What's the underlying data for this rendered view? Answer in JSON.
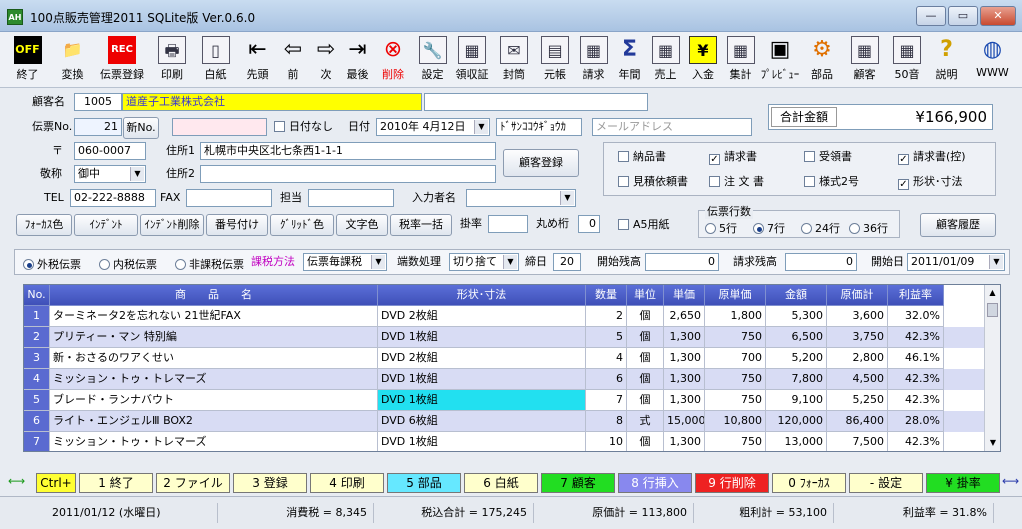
{
  "title": "100点販売管理2011 SQLite版 Ver.0.6.0",
  "app_icon": "AH",
  "toolbar": [
    {
      "label": "終了",
      "icon": "OFF"
    },
    {
      "label": "変換",
      "icon": "folder-icon"
    },
    {
      "label": "伝票登録",
      "icon": "REC"
    },
    {
      "label": "印刷",
      "icon": "printer-icon"
    },
    {
      "label": "白紙",
      "icon": "blank-page-icon"
    },
    {
      "label": "先頭",
      "icon": "first-icon"
    },
    {
      "label": "前",
      "icon": "prev-icon"
    },
    {
      "label": "次",
      "icon": "next-icon"
    },
    {
      "label": "最後",
      "icon": "last-icon"
    },
    {
      "label": "削除",
      "icon": "delete-icon"
    },
    {
      "label": "設定",
      "icon": "wrench-icon"
    },
    {
      "label": "領収証",
      "icon": "receipt-icon"
    },
    {
      "label": "封筒",
      "icon": "envelope-icon"
    },
    {
      "label": "元帳",
      "icon": "ledger-icon"
    },
    {
      "label": "請求",
      "icon": "invoice-icon"
    },
    {
      "label": "年間",
      "icon": "sigma-icon"
    },
    {
      "label": "売上",
      "icon": "sales-icon"
    },
    {
      "label": "入金",
      "icon": "yen-icon"
    },
    {
      "label": "集計",
      "icon": "summary-icon"
    },
    {
      "label": "ﾌﾟﾚﾋﾞｭｰ",
      "icon": "preview-icon"
    },
    {
      "label": "部品",
      "icon": "gear-icon"
    },
    {
      "label": "顧客",
      "icon": "customer-icon"
    },
    {
      "label": "50音",
      "icon": "kana-icon"
    },
    {
      "label": "説明",
      "icon": "help-icon"
    },
    {
      "label": "WWW",
      "icon": "globe-icon"
    }
  ],
  "form": {
    "customer_name_label": "顧客名",
    "customer_code": "1005",
    "customer_name": "道産子工業株式会社",
    "slip_no_label": "伝票No.",
    "slip_no": "21",
    "new_no_button": "新No.",
    "no_date_label": "日付なし",
    "date_label": "日付",
    "date": "2010年 4月12日",
    "kana": "ﾄﾞｻﾝｺｺｳｷﾞｮｳｶ",
    "email_placeholder": "メールアドレス",
    "total_label": "合計金額",
    "total": "¥166,900",
    "postal_label": "〒",
    "postal": "060-0007",
    "address1_label": "住所1",
    "address1": "札幌市中央区北七条西1-1-1",
    "register_customer_button": "顧客登録",
    "honorific_label": "敬称",
    "honorific": "御中",
    "address2_label": "住所2",
    "tel_label": "TEL",
    "tel": "02-222-8888",
    "fax_label": "FAX",
    "person_label": "担当",
    "entry_name_label": "入力者名"
  },
  "checks": [
    {
      "label": "納品書",
      "checked": false
    },
    {
      "label": "請求書",
      "checked": true
    },
    {
      "label": "受領書",
      "checked": false
    },
    {
      "label": "請求書(控)",
      "checked": true
    },
    {
      "label": "見積依頼書",
      "checked": false
    },
    {
      "label": "注 文 書",
      "checked": false
    },
    {
      "label": "様式2号",
      "checked": false
    },
    {
      "label": "形状･寸法",
      "checked": true
    }
  ],
  "format_buttons": [
    "ﾌｫｰｶｽ色",
    "ｲﾝﾃﾞﾝﾄ",
    "ｲﾝﾃﾞﾝﾄ削除",
    "番号付け",
    "ｸﾞﾘｯﾄﾞ色",
    "文字色",
    "税率一括"
  ],
  "tax_rate_label": "掛率",
  "rounding_label": "丸め桁",
  "rounding": "0",
  "a5_label": "A5用紙",
  "slip_lines": {
    "title": "伝票行数",
    "options": [
      "5行",
      "7行",
      "24行",
      "36行"
    ],
    "selected": "7行"
  },
  "history_button": "顧客履歴",
  "tax": {
    "options": [
      "外税伝票",
      "内税伝票",
      "非課税伝票"
    ],
    "selected": "外税伝票",
    "method_label": "課税方法",
    "method": "伝票毎課税",
    "fraction_label": "端数処理",
    "fraction": "切り捨て",
    "closing_label": "締日",
    "closing": "20",
    "opening_label": "開始残高",
    "opening": "0",
    "billing_label": "請求残高",
    "billing": "0",
    "start_label": "開始日",
    "start": "2011/01/09"
  },
  "table": {
    "headers": [
      "No.",
      "商　　品　　名",
      "形状･寸法",
      "数量",
      "単位",
      "単価",
      "原単価",
      "金額",
      "原価計",
      "利益率"
    ],
    "rows": [
      {
        "no": "1",
        "name": "ターミネータ2を忘れない 21世紀FAX",
        "spec": "DVD 2枚組",
        "qty": "2",
        "unit": "個",
        "price": "2,650",
        "cost": "1,800",
        "amount": "5,300",
        "cost_total": "3,600",
        "margin": "32.0%"
      },
      {
        "no": "2",
        "name": "プリティー・マン 特別編",
        "spec": "DVD 1枚組",
        "qty": "5",
        "unit": "個",
        "price": "1,300",
        "cost": "750",
        "amount": "6,500",
        "cost_total": "3,750",
        "margin": "42.3%"
      },
      {
        "no": "3",
        "name": "新・おさるのワアくせい",
        "spec": "DVD 2枚組",
        "qty": "4",
        "unit": "個",
        "price": "1,300",
        "cost": "700",
        "amount": "5,200",
        "cost_total": "2,800",
        "margin": "46.1%"
      },
      {
        "no": "4",
        "name": "ミッション・トゥ・トレマーズ",
        "spec": "DVD 1枚組",
        "qty": "6",
        "unit": "個",
        "price": "1,300",
        "cost": "750",
        "amount": "7,800",
        "cost_total": "4,500",
        "margin": "42.3%"
      },
      {
        "no": "5",
        "name": "ブレード・ランナバウト",
        "spec": "DVD 1枚組",
        "qty": "7",
        "unit": "個",
        "price": "1,300",
        "cost": "750",
        "amount": "9,100",
        "cost_total": "5,250",
        "margin": "42.3%"
      },
      {
        "no": "6",
        "name": "ライト・エンジェルⅢ BOX2",
        "spec": "DVD 6枚組",
        "qty": "8",
        "unit": "式",
        "price": "15,000",
        "cost": "10,800",
        "amount": "120,000",
        "cost_total": "86,400",
        "margin": "28.0%"
      },
      {
        "no": "7",
        "name": "ミッション・トゥ・トレマーズ",
        "spec": "DVD 1枚組",
        "qty": "10",
        "unit": "個",
        "price": "1,300",
        "cost": "750",
        "amount": "13,000",
        "cost_total": "7,500",
        "margin": "42.3%"
      }
    ]
  },
  "fkeys": [
    {
      "label": "Ctrl+",
      "bg": "#ffff33"
    },
    {
      "label": "1 終了",
      "bg": "#ffffcc"
    },
    {
      "label": "2 ファイル",
      "bg": "#ffffcc"
    },
    {
      "label": "3 登録",
      "bg": "#ffffcc"
    },
    {
      "label": "4 印刷",
      "bg": "#ffffcc"
    },
    {
      "label": "5 部品",
      "bg": "#66e8ff"
    },
    {
      "label": "6 白紙",
      "bg": "#ffffcc"
    },
    {
      "label": "7 顧客",
      "bg": "#22dd22"
    },
    {
      "label": "8 行挿入",
      "bg": "#8888ee"
    },
    {
      "label": "9 行削除",
      "bg": "#ee2222"
    },
    {
      "label": "0 ﾌｫｰｶｽ",
      "bg": "#ffffcc"
    },
    {
      "label": "- 設定",
      "bg": "#ffffcc"
    },
    {
      "label": "¥ 掛率",
      "bg": "#22dd22"
    }
  ],
  "status": {
    "date": "2011/01/12 (水曜日)",
    "tax": "消費税 = 8,345",
    "incl": "税込合計 = 175,245",
    "cost": "原価計 = 113,800",
    "profit": "粗利計 = 53,100",
    "margin": "利益率 = 31.8%"
  }
}
